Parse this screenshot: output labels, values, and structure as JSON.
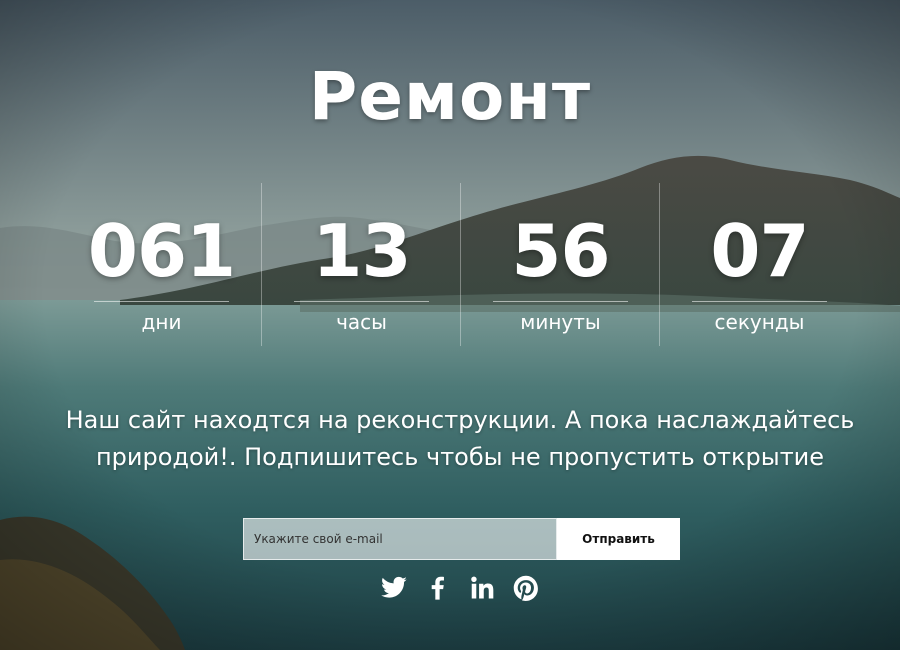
{
  "logo": {
    "text": "Ремонт"
  },
  "countdown": {
    "items": [
      {
        "value": "061",
        "label": "дни"
      },
      {
        "value": "13",
        "label": "часы"
      },
      {
        "value": "56",
        "label": "минуты"
      },
      {
        "value": "07",
        "label": "секунды"
      }
    ]
  },
  "message": {
    "line1": "Наш сайт находтся на реконструкции. А пока наслаждайтесь",
    "line2": "природой!. Подпишитесь чтобы не пропустить открытие"
  },
  "subscribe": {
    "placeholder": "Укажите свой e-mail",
    "button_label": "Отправить"
  },
  "social": [
    {
      "icon": "twitter-icon"
    },
    {
      "icon": "facebook-icon"
    },
    {
      "icon": "linkedin-icon"
    },
    {
      "icon": "pinterest-icon"
    }
  ],
  "colors": {
    "sky_top": "#4a5a66",
    "water": "#2d5a5c",
    "mountains": "#3e4a44",
    "text": "#ffffff",
    "button_bg": "#ffffff"
  }
}
